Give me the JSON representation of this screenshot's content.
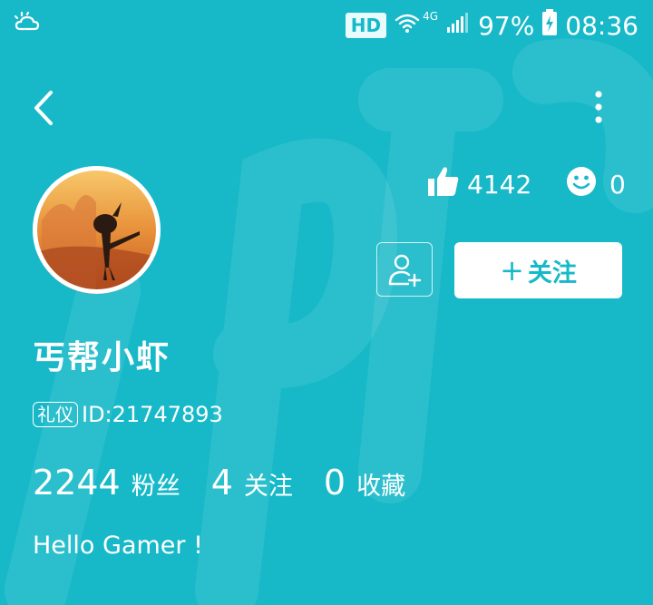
{
  "status_bar": {
    "hd": "HD",
    "network": "4G",
    "battery": "97%",
    "time": "08:36"
  },
  "profile": {
    "likes": "4142",
    "smiles": "0",
    "username": "丐帮小虾",
    "badge": "礼仪",
    "id_text": "ID:21747893",
    "follow_label": "关注",
    "bio": "Hello Gamer !"
  },
  "stats": [
    {
      "value": "2244",
      "label": "粉丝"
    },
    {
      "value": "4",
      "label": "关注"
    },
    {
      "value": "0",
      "label": "收藏"
    }
  ],
  "icons": {
    "weather": "weather-icon",
    "wifi": "wifi-icon",
    "signal": "signal-icon",
    "battery": "battery-charging-icon",
    "back": "back-arrow-icon",
    "more": "more-vertical-icon",
    "like": "thumbs-up-icon",
    "smile": "smile-icon",
    "add_friend": "add-friend-icon",
    "plus": "plus-icon"
  },
  "colors": {
    "background": "#17b9c9",
    "text": "#ffffff",
    "button_bg": "#ffffff",
    "button_text": "#17b9c9"
  }
}
